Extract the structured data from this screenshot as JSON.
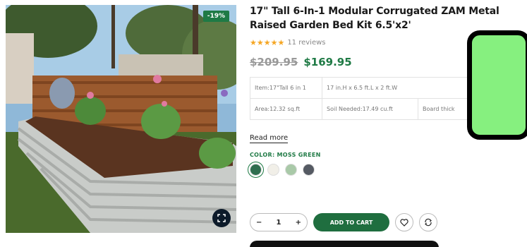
{
  "product": {
    "title": "17\" Tall 6-In-1 Modular Corrugated ZAM Metal Raised Garden Bed Kit 6.5'x2'",
    "discount_badge": "-19%",
    "stars": "★★★★★",
    "reviews": "11 reviews",
    "old_price": "$209.95",
    "new_price": "$169.95",
    "specs": {
      "row1": [
        "Item:17\"Tall 6 in 1",
        "17 in.H x 6.5 ft.L x 2 ft.W"
      ],
      "row2": [
        "Area:12.32 sq.ft",
        "Soil Needed:17.49 cu.ft",
        "Board thick"
      ]
    },
    "read_more": "Read more",
    "color_label": "COLOR: MOSS GREEN",
    "swatches": [
      "#2f6e4f",
      "#f1efe8",
      "#a9c9a8",
      "#555a63"
    ],
    "selected_swatch_index": 0
  },
  "cart": {
    "minus": "−",
    "quantity": "1",
    "plus": "+",
    "add_to_cart_label": "ADD TO CART"
  },
  "icons": {
    "zoom": "expand-icon",
    "wishlist": "heart-icon",
    "compare": "refresh-icon"
  },
  "colors": {
    "accent": "#1f7a45",
    "overlay": "#86f07f"
  }
}
